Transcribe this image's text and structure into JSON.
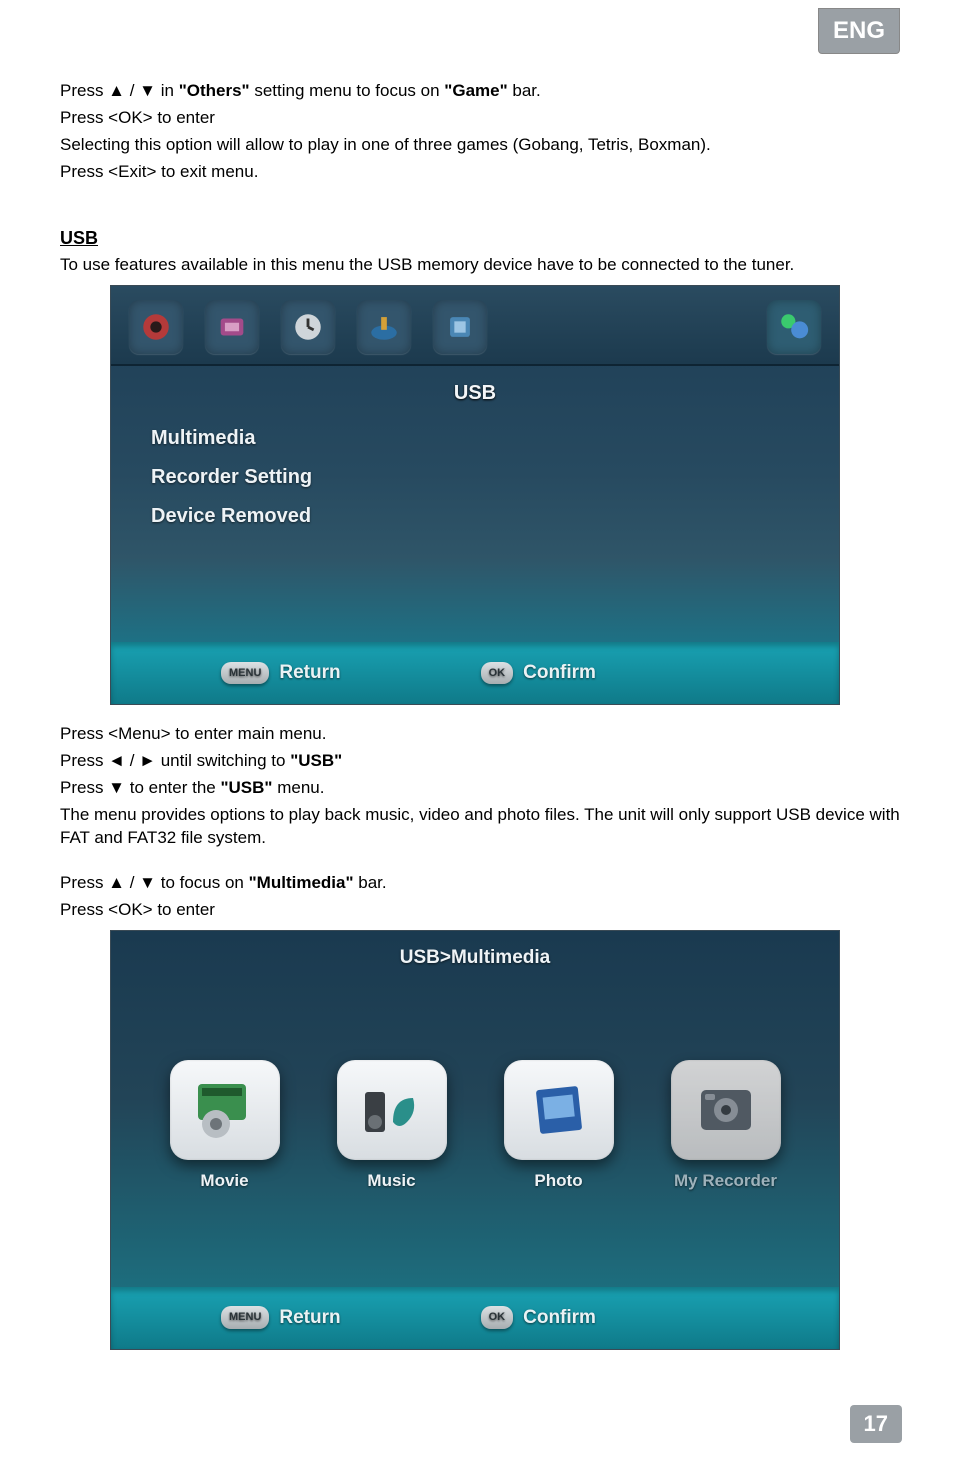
{
  "badge": "ENG",
  "page_number": "17",
  "intro": {
    "line1_pre": "Press ▲ / ▼ in ",
    "line1_b1": "\"Others\"",
    "line1_mid": " setting menu to focus on ",
    "line1_b2": "\"Game\"",
    "line1_post": " bar.",
    "line2": "Press <OK> to enter",
    "line3": "Selecting this option will allow to play in one of three games (Gobang, Tetris, Boxman).",
    "line4": "Press <Exit> to exit menu."
  },
  "usb_heading": "USB",
  "usb_intro": "To use features available in this menu the USB memory device have to be connected to the tuner.",
  "screenshot1": {
    "title": "USB",
    "items": [
      "Multimedia",
      "Recorder Setting",
      "Device Removed"
    ],
    "footer": {
      "menu_key": "MENU",
      "return": "Return",
      "ok_key": "OK",
      "confirm": "Confirm"
    }
  },
  "after1": {
    "l1": "Press <Menu> to enter main menu.",
    "l2_pre": "Press ◄ / ►  until switching to ",
    "l2_b": "\"USB\"",
    "l3_pre": "Press ▼ to enter the ",
    "l3_b": "\"USB\"",
    "l3_post": " menu.",
    "l4": "The menu provides options to play back music, video  and photo files. The unit will only support USB device with FAT and FAT32 file system."
  },
  "after2": {
    "l1_pre": "Press ▲ / ▼  to focus on ",
    "l1_b": "\"Multimedia\"",
    "l1_post": " bar.",
    "l2": "Press <OK> to enter"
  },
  "screenshot2": {
    "breadcrumb": "USB>Multimedia",
    "items": [
      {
        "label": "Movie",
        "dim": false
      },
      {
        "label": "Music",
        "dim": false
      },
      {
        "label": "Photo",
        "dim": false
      },
      {
        "label": "My Recorder",
        "dim": true
      }
    ],
    "footer": {
      "menu_key": "MENU",
      "return": "Return",
      "ok_key": "OK",
      "confirm": "Confirm"
    }
  }
}
